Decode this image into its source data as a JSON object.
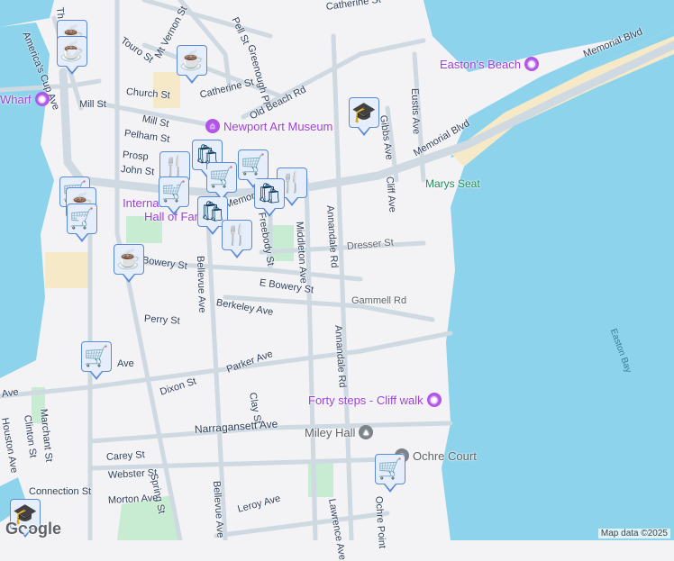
{
  "streets": [
    {
      "name": "Catherine St",
      "key": "s1"
    },
    {
      "name": "Touro St",
      "key": "s2"
    },
    {
      "name": "Mt Vernon St",
      "key": "s3"
    },
    {
      "name": "Pell St",
      "key": "s4"
    },
    {
      "name": "Greenough Pl",
      "key": "s5"
    },
    {
      "name": "Catherine St",
      "key": "s6"
    },
    {
      "name": "Old Beach Rd",
      "key": "s7"
    },
    {
      "name": "Church St",
      "key": "s8"
    },
    {
      "name": "Mill St",
      "key": "s9"
    },
    {
      "name": "Mill St",
      "key": "s10"
    },
    {
      "name": "Pelham St",
      "key": "s11"
    },
    {
      "name": "Prosp",
      "key": "s12"
    },
    {
      "name": "John St",
      "key": "s13"
    },
    {
      "name": "America's Cup Ave",
      "key": "s14"
    },
    {
      "name": "Memorial Blvd",
      "key": "s15"
    },
    {
      "name": "Memorial Blvd",
      "key": "s16"
    },
    {
      "name": "Memorial Blvd",
      "key": "s17"
    },
    {
      "name": "Gibbs Ave",
      "key": "s18"
    },
    {
      "name": "Eustis Ave",
      "key": "s19"
    },
    {
      "name": "Cliff Ave",
      "key": "s20"
    },
    {
      "name": "Annandale Rd",
      "key": "s21"
    },
    {
      "name": "Annandale Rd",
      "key": "s22"
    },
    {
      "name": "Middleton Ave",
      "key": "s23"
    },
    {
      "name": "Freebody St",
      "key": "s24"
    },
    {
      "name": "Dresser St",
      "key": "s25"
    },
    {
      "name": "Bowery St",
      "key": "s26"
    },
    {
      "name": "E Bowery St",
      "key": "s27"
    },
    {
      "name": "Gammell Rd",
      "key": "s28"
    },
    {
      "name": "Berkeley Ave",
      "key": "s29"
    },
    {
      "name": "Bellevue Ave",
      "key": "s30"
    },
    {
      "name": "Perry St",
      "key": "s31"
    },
    {
      "name": "Ave",
      "key": "s32"
    },
    {
      "name": "Parker Ave",
      "key": "s33"
    },
    {
      "name": "Dixon St",
      "key": "s34"
    },
    {
      "name": "Clay St",
      "key": "s35"
    },
    {
      "name": "Ave",
      "key": "s36"
    },
    {
      "name": "Houston Ave",
      "key": "s37"
    },
    {
      "name": "Clinton St",
      "key": "s38"
    },
    {
      "name": "Marchant St",
      "key": "s39"
    },
    {
      "name": "Narragansett Ave",
      "key": "s40"
    },
    {
      "name": "Carey St",
      "key": "s41"
    },
    {
      "name": "Webster St",
      "key": "s42"
    },
    {
      "name": "Spring St",
      "key": "s43"
    },
    {
      "name": "Bellevue Ave",
      "key": "s44"
    },
    {
      "name": "Connection St",
      "key": "s45"
    },
    {
      "name": "Morton Ave",
      "key": "s46"
    },
    {
      "name": "Leroy Ave",
      "key": "s47"
    },
    {
      "name": "Lawrence Ave",
      "key": "s48"
    },
    {
      "name": "Ochre Point",
      "key": "s49"
    },
    {
      "name": "Th",
      "key": "s50"
    }
  ],
  "pois": {
    "eastons_beach": "Easton's Beach",
    "wharf": "Wharf",
    "art_museum": "Newport Art Museum",
    "hall_of_fame_1": "International",
    "hall_of_fame_2": "Hall of Fame",
    "marys_seat": "Marys Seat",
    "forty_steps": "Forty steps - Cliff walk",
    "miley_hall": "Miley Hall",
    "ochre_court": "Ochre Court",
    "easton_bay": "Easton Bay"
  },
  "markers": [
    {
      "type": "cafe",
      "icon": "☕"
    },
    {
      "type": "cafe",
      "icon": "☕"
    },
    {
      "type": "cafe",
      "icon": "☕"
    },
    {
      "type": "school",
      "icon": "🎓"
    },
    {
      "type": "shopping",
      "icon": "🛍"
    },
    {
      "type": "restaurant",
      "icon": "🍴"
    },
    {
      "type": "grocery",
      "icon": "🛒"
    },
    {
      "type": "restaurant",
      "icon": "🍴"
    },
    {
      "type": "shopping",
      "icon": "🛍"
    },
    {
      "type": "grocery",
      "icon": "🛒"
    },
    {
      "type": "cafe",
      "icon": "☕"
    },
    {
      "type": "grocery",
      "icon": "🛒"
    },
    {
      "type": "shopping",
      "icon": "🛍"
    },
    {
      "type": "grocery",
      "icon": "🛒"
    },
    {
      "type": "restaurant",
      "icon": "🍴"
    },
    {
      "type": "cafe",
      "icon": "☕"
    },
    {
      "type": "grocery",
      "icon": "🛒"
    },
    {
      "type": "grocery",
      "icon": "🛒"
    },
    {
      "type": "school",
      "icon": "🎓"
    }
  ],
  "attribution": "Map data ©2025",
  "logo": "Google",
  "colors": {
    "water": "#8dd3ec",
    "land": "#f3f2f4",
    "road": "#cfd9e2",
    "park": "#c7ecd2",
    "poi": "#9b3fd8",
    "marker_icon": "#0c3e60"
  }
}
